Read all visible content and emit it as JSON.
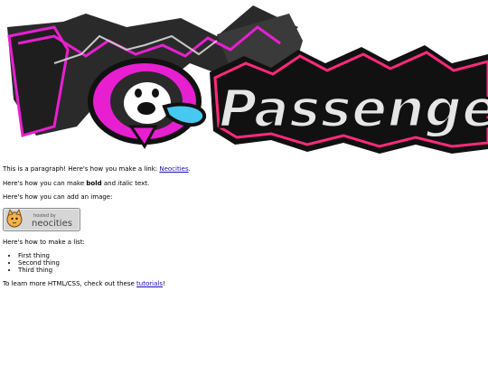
{
  "banner": {
    "logo_text": "Passenger",
    "colors": {
      "magenta": "#e81fd1",
      "black": "#141414",
      "pink": "#ff2a7a",
      "cyan": "#46c8f0",
      "gray": "#9a9a9a"
    }
  },
  "content": {
    "p1": {
      "before": "This is a paragraph! Here's how you make a link: ",
      "link": "Neocities",
      "after": "."
    },
    "p2": {
      "before": "Here's how you can make ",
      "bold": "bold",
      "middle": " and ",
      "italic": "italic",
      "after": " text."
    },
    "p3": "Here's how you can add an image:",
    "badge": {
      "small": "hosted by",
      "big": "neocities"
    },
    "p4": "Here's how to make a list:",
    "list": [
      "First thing",
      "Second thing",
      "Third thing"
    ],
    "p5": {
      "before": "To learn more HTML/CSS, check out these ",
      "link": "tutorials",
      "after": "!"
    }
  }
}
